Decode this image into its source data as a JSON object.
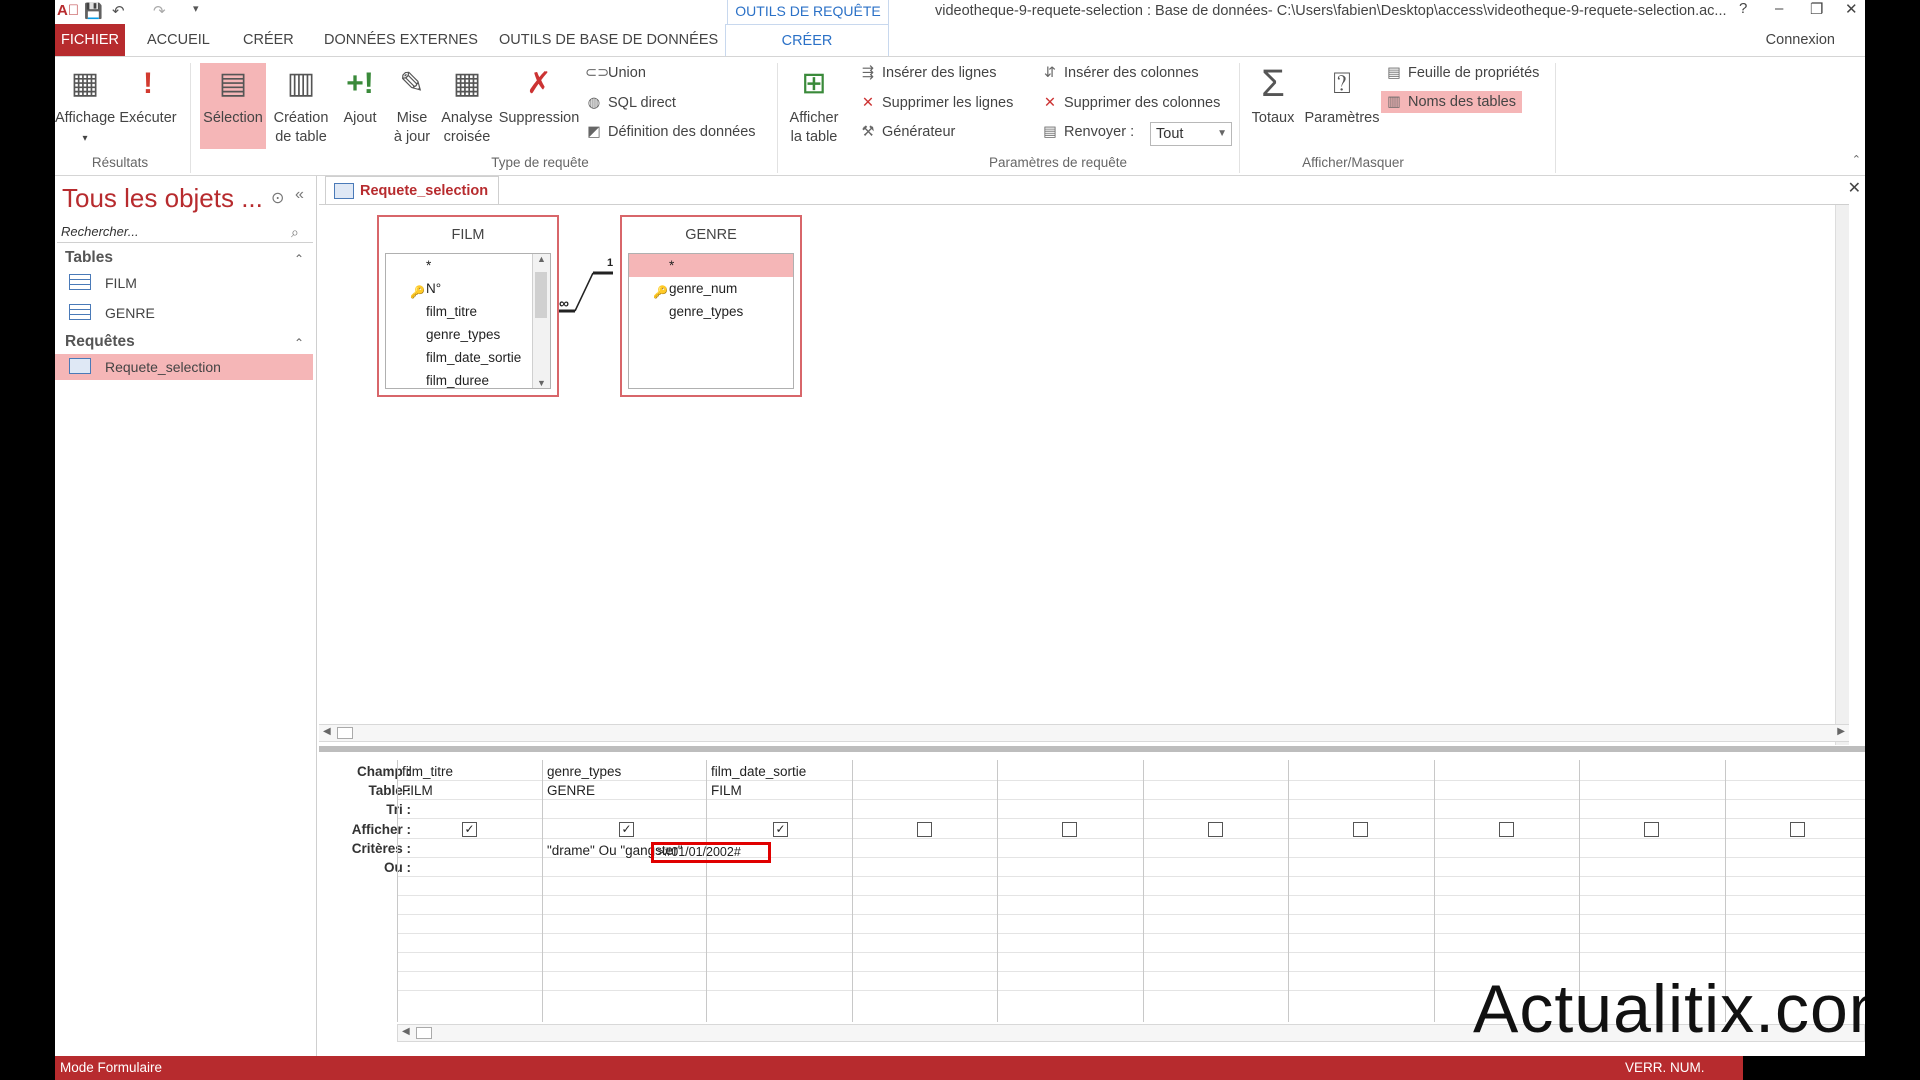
{
  "title_bar": {
    "contextual_tab": "OUTILS DE REQUÊTE",
    "window_title": "videotheque-9-requete-selection : Base de données- C:\\Users\\fabien\\Desktop\\access\\videotheque-9-requete-selection.ac...",
    "help": "?",
    "minimize": "–",
    "restore": "❐",
    "close": "✕"
  },
  "tabs": {
    "fichier": "FICHIER",
    "accueil": "ACCUEIL",
    "creer": "CRÉER",
    "donnees_externes": "DONNÉES EXTERNES",
    "outils_bdd": "OUTILS DE BASE DE DONNÉES",
    "creer_ctx": "CRÉER",
    "connexion": "Connexion"
  },
  "ribbon": {
    "affichage": "Affichage",
    "executer": "Exécuter",
    "resultats": "Résultats",
    "selection": "Sélection",
    "creation_table_1": "Création",
    "creation_table_2": "de table",
    "ajout": "Ajout",
    "mise_a_jour_1": "Mise",
    "mise_a_jour_2": "à jour",
    "analyse_1": "Analyse",
    "analyse_2": "croisée",
    "suppression": "Suppression",
    "union": "Union",
    "sql_direct": "SQL direct",
    "definition_donnees": "Définition des données",
    "type_requete": "Type de requête",
    "afficher_table_1": "Afficher",
    "afficher_table_2": "la table",
    "inserer_lignes": "Insérer des lignes",
    "supprimer_lignes": "Supprimer les lignes",
    "generateur": "Générateur",
    "inserer_colonnes": "Insérer des colonnes",
    "supprimer_colonnes": "Supprimer des colonnes",
    "renvoyer": "Renvoyer :",
    "renvoyer_value": "Tout",
    "parametres_requete": "Paramètres de requête",
    "totaux": "Totaux",
    "parametres": "Paramètres",
    "feuille_proprietes": "Feuille de propriétés",
    "noms_tables": "Noms des tables",
    "afficher_masquer": "Afficher/Masquer"
  },
  "nav": {
    "title": "Tous les objets ...",
    "search_placeholder": "Rechercher...",
    "tables_header": "Tables",
    "tables": [
      "FILM",
      "GENRE"
    ],
    "requetes_header": "Requêtes",
    "requetes": [
      "Requete_selection"
    ]
  },
  "document": {
    "tab_label": "Requete_selection",
    "film_table": {
      "name": "FILM",
      "fields": [
        "*",
        "N°",
        "film_titre",
        "genre_types",
        "film_date_sortie",
        "film_duree"
      ]
    },
    "genre_table": {
      "name": "GENRE",
      "fields": [
        "*",
        "genre_num",
        "genre_types"
      ]
    },
    "join": {
      "one_side": "1",
      "many_side": "∞"
    }
  },
  "grid": {
    "row_labels": {
      "champ": "Champ :",
      "table": "Table :",
      "tri": "Tri :",
      "afficher": "Afficher :",
      "criteres": "Critères :",
      "ou": "Ou :"
    },
    "columns": [
      {
        "champ": "film_titre",
        "table": "FILM",
        "afficher": true,
        "criteres": ""
      },
      {
        "champ": "genre_types",
        "table": "GENRE",
        "afficher": true,
        "criteres": "\"drame\" Ou \"gangster\""
      },
      {
        "champ": "film_date_sortie",
        "table": "FILM",
        "afficher": true,
        "criteres": ">#01/01/2002#"
      }
    ]
  },
  "status": {
    "left": "Mode Formulaire",
    "right": "VERR. NUM."
  },
  "watermark": "Actualitix.com",
  "colors": {
    "accent": "#b72b2e",
    "highlight": "#f5b6b7",
    "criteria_border": "#e00000"
  }
}
